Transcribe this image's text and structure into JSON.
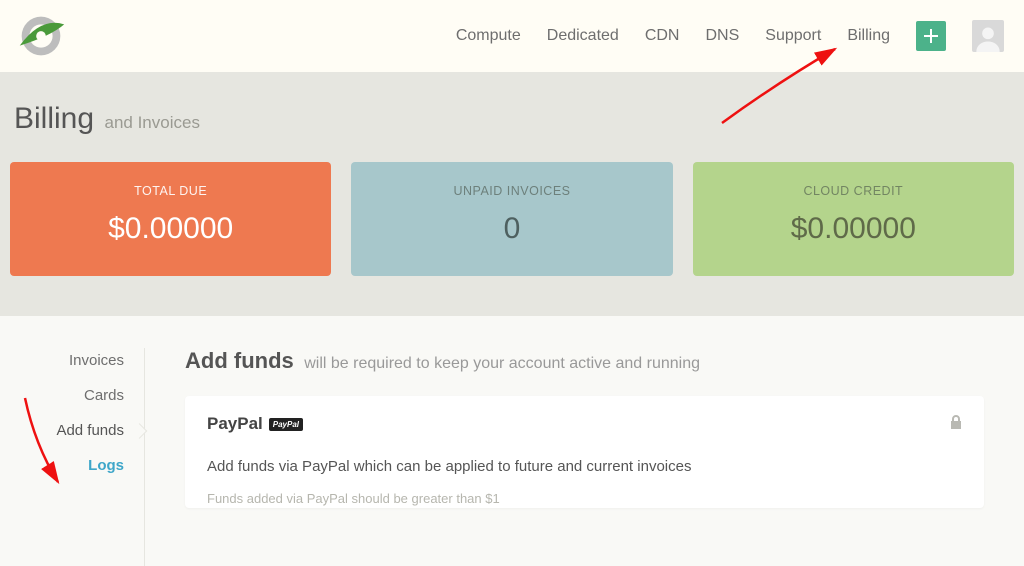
{
  "nav": {
    "items": [
      "Compute",
      "Dedicated",
      "CDN",
      "DNS",
      "Support",
      "Billing"
    ]
  },
  "page": {
    "title": "Billing",
    "subtitle": "and Invoices"
  },
  "stats": [
    {
      "label": "TOTAL DUE",
      "value": "$0.00000"
    },
    {
      "label": "UNPAID INVOICES",
      "value": "0"
    },
    {
      "label": "CLOUD CREDIT",
      "value": "$0.00000"
    }
  ],
  "sidebar": {
    "items": [
      "Invoices",
      "Cards",
      "Add funds",
      "Logs"
    ]
  },
  "addfunds": {
    "title": "Add funds",
    "subtitle": "will be required to keep your account active and running",
    "panel": {
      "provider": "PayPal",
      "badge": "PayPal",
      "desc": "Add funds via PayPal which can be applied to future and current invoices",
      "note": "Funds added via PayPal should be greater than $1"
    }
  }
}
